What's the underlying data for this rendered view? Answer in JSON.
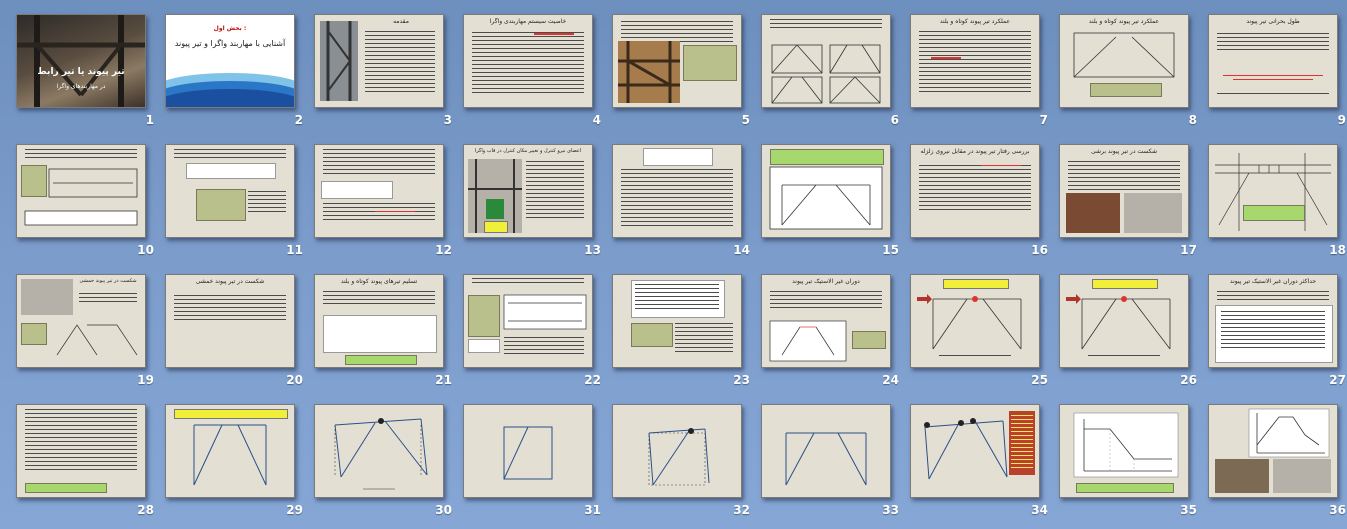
{
  "app": {
    "view": "Slide Sorter"
  },
  "slides": [
    {
      "n": "1",
      "title": "تیر پیوند یا تیر رابط",
      "subtitle": "در مهاربندهای واگرا"
    },
    {
      "n": "2",
      "title": "آشنایی با مهاربند واگرا و تیر پیوند",
      "kicker": "بخش اول :"
    },
    {
      "n": "3",
      "title": "مقدمه"
    },
    {
      "n": "4",
      "title": "خاصیت سیستم مهاربندی واگرا"
    },
    {
      "n": "5",
      "title": ""
    },
    {
      "n": "6",
      "title": ""
    },
    {
      "n": "7",
      "title": "عملکرد تیر پیوند کوتاه و بلند"
    },
    {
      "n": "8",
      "title": "عملکرد تیر پیوند کوتاه و بلند"
    },
    {
      "n": "9",
      "title": "طول بحرانی تیر پیوند"
    },
    {
      "n": "10",
      "title": ""
    },
    {
      "n": "11",
      "title": ""
    },
    {
      "n": "12",
      "title": ""
    },
    {
      "n": "13",
      "title": "اعضای نیرو کنترل و تغییر مکان کنترل در قاب واگرا"
    },
    {
      "n": "14",
      "title": ""
    },
    {
      "n": "15",
      "title": ""
    },
    {
      "n": "16",
      "title": "بررسی رفتار تیر پیوند در مقابل نیروی زلزله"
    },
    {
      "n": "17",
      "title": "شکست در تیر پیوند برشی"
    },
    {
      "n": "18",
      "title": ""
    },
    {
      "n": "19",
      "title": "شکست در تیر پیوند خمشی"
    },
    {
      "n": "20",
      "title": "شکست در تیر پیوند خمشی"
    },
    {
      "n": "21",
      "title": "تسلیم تیرهای پیوند کوتاه و بلند"
    },
    {
      "n": "22",
      "title": ""
    },
    {
      "n": "23",
      "title": ""
    },
    {
      "n": "24",
      "title": "دوران غیر الاستیک تیر پیوند"
    },
    {
      "n": "25",
      "title": ""
    },
    {
      "n": "26",
      "title": ""
    },
    {
      "n": "27",
      "title": "حداکثر دوران غیر الاستیک تیر پیوند"
    },
    {
      "n": "28",
      "title": ""
    },
    {
      "n": "29",
      "title": ""
    },
    {
      "n": "30",
      "title": ""
    },
    {
      "n": "31",
      "title": ""
    },
    {
      "n": "32",
      "title": ""
    },
    {
      "n": "33",
      "title": ""
    },
    {
      "n": "34",
      "title": ""
    },
    {
      "n": "35",
      "title": ""
    },
    {
      "n": "36",
      "title": ""
    }
  ],
  "colors": {
    "background": "#7b9ccb",
    "slide": "#e3dfd3",
    "highlight": "#f2ef3a",
    "note": "#b9c08b",
    "accent_red": "#d33333"
  }
}
